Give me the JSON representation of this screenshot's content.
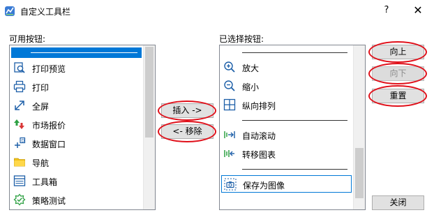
{
  "window": {
    "title": "自定义工具栏",
    "help_glyph": "?",
    "close_glyph": "✕"
  },
  "available": {
    "label": "可用按钮:",
    "items": [
      {
        "label": "打印预览",
        "icon": "print-preview-icon"
      },
      {
        "label": "打印",
        "icon": "printer-icon"
      },
      {
        "label": "全屏",
        "icon": "fullscreen-icon"
      },
      {
        "label": "市场报价",
        "icon": "market-quotes-icon"
      },
      {
        "label": "数据窗口",
        "icon": "data-window-icon"
      },
      {
        "label": "导航",
        "icon": "folder-icon"
      },
      {
        "label": "工具箱",
        "icon": "toolbox-icon"
      },
      {
        "label": "策略测试",
        "icon": "strategy-tester-icon"
      }
    ]
  },
  "selected": {
    "label": "已选择按钮:",
    "items": [
      {
        "label": "放大",
        "icon": "zoom-in-icon"
      },
      {
        "label": "缩小",
        "icon": "zoom-out-icon"
      },
      {
        "label": "纵向排列",
        "icon": "tile-vertically-icon"
      },
      {
        "label": "自动滚动",
        "icon": "auto-scroll-icon"
      },
      {
        "label": "转移图表",
        "icon": "chart-shift-icon"
      },
      {
        "label": "保存为图像",
        "icon": "camera-icon"
      }
    ]
  },
  "buttons": {
    "insert": "插入 ->",
    "remove": "<- 移除",
    "up": "向上",
    "down": "向下",
    "reset": "重置",
    "close": "关闭"
  },
  "colors": {
    "highlight": "#0078d7",
    "annotation_ring": "#e0101a"
  }
}
